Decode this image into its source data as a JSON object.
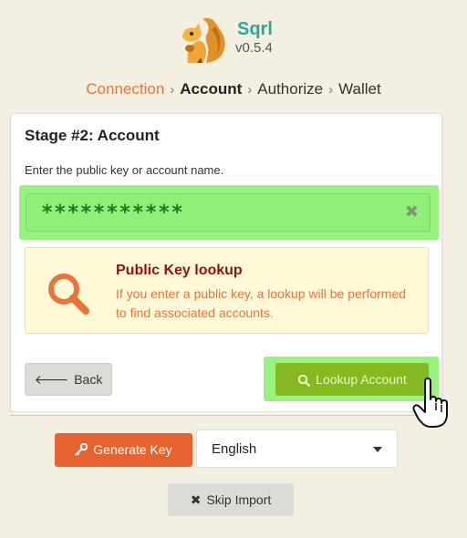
{
  "app": {
    "name": "Sqrl",
    "version": "v0.5.4"
  },
  "steps": [
    {
      "label": "Connection",
      "state": "done"
    },
    {
      "label": "Account",
      "state": "active"
    },
    {
      "label": "Authorize",
      "state": "pending"
    },
    {
      "label": "Wallet",
      "state": "pending"
    }
  ],
  "stage": {
    "title": "Stage #2: Account",
    "instructions": "Enter the public key or account name."
  },
  "key_input": {
    "value": "***********"
  },
  "lookup_info": {
    "title": "Public Key lookup",
    "text": "If you enter a public key, a lookup will be performed to find associated accounts."
  },
  "buttons": {
    "back": "Back",
    "lookup": "Lookup Account",
    "generate": "Generate Key",
    "skip": "Skip Import"
  },
  "language": {
    "selected": "English"
  },
  "colors": {
    "accent_orange": "#e8743b",
    "highlight_green": "#99f27f",
    "lookup_button": "#86b81f",
    "generate_button": "#e8622f",
    "lookup_title": "#8b1414"
  },
  "icons": {
    "logo": "squirrel-icon",
    "clear": "times-icon",
    "lookup": "search-icon",
    "back": "arrow-left-icon",
    "generate": "key-icon",
    "skip": "times-icon",
    "pointer": "hand-pointer-icon"
  }
}
